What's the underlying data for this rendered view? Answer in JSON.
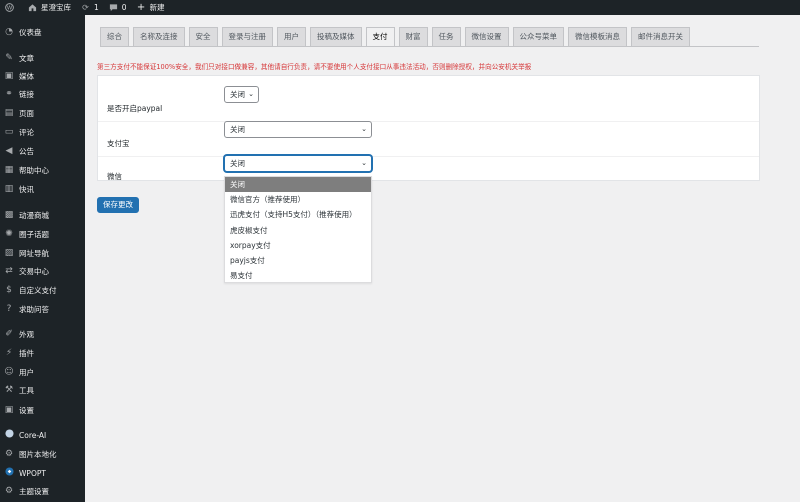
{
  "adminbar": {
    "site_name": "星澄宝库",
    "updates_count": "1",
    "comments_count": "0",
    "new_label": "新建"
  },
  "sidebar": {
    "items": [
      {
        "label": "仪表盘",
        "icon": "dashboard-icon"
      },
      {
        "label": "文章",
        "icon": "pin-icon"
      },
      {
        "label": "媒体",
        "icon": "media-icon"
      },
      {
        "label": "链接",
        "icon": "link-icon"
      },
      {
        "label": "页面",
        "icon": "page-icon"
      },
      {
        "label": "评论",
        "icon": "comment-icon"
      },
      {
        "label": "公告",
        "icon": "megaphone-icon"
      },
      {
        "label": "帮助中心",
        "icon": "calendar-icon"
      },
      {
        "label": "快讯",
        "icon": "document-icon"
      },
      {
        "label": "动漫商城",
        "icon": "store-icon"
      },
      {
        "label": "圈子话题",
        "icon": "circle-icon"
      },
      {
        "label": "网址导航",
        "icon": "nav-icon"
      },
      {
        "label": "交易中心",
        "icon": "exchange-icon"
      },
      {
        "label": "自定义支付",
        "icon": "dollar-icon"
      },
      {
        "label": "求助问答",
        "icon": "question-icon"
      },
      {
        "label": "外观",
        "icon": "brush-icon"
      },
      {
        "label": "插件",
        "icon": "plugin-icon"
      },
      {
        "label": "用户",
        "icon": "user-icon"
      },
      {
        "label": "工具",
        "icon": "wrench-icon"
      },
      {
        "label": "设置",
        "icon": "settings-icon"
      },
      {
        "label": "Core-AI",
        "icon": "ai-icon"
      },
      {
        "label": "图片本地化",
        "icon": "gear-icon"
      },
      {
        "label": "WPOPT",
        "icon": "wpopt-icon"
      },
      {
        "label": "主题设置",
        "icon": "theme-gear-icon"
      }
    ]
  },
  "tabs": [
    {
      "label": "综合"
    },
    {
      "label": "名称及连接"
    },
    {
      "label": "安全"
    },
    {
      "label": "登录与注册"
    },
    {
      "label": "用户"
    },
    {
      "label": "投稿及媒体"
    },
    {
      "label": "支付"
    },
    {
      "label": "财富"
    },
    {
      "label": "任务"
    },
    {
      "label": "微信设置"
    },
    {
      "label": "公众号菜单"
    },
    {
      "label": "微信模板消息"
    },
    {
      "label": "邮件消息开关"
    }
  ],
  "notice": "第三方支付不能保证100%安全，我们只对接口做兼容，其他请自行负责，请不要使用个人支付接口从事违法活动，否则删除授权，并向公安机关举报",
  "form": {
    "paypal_label": "是否开启paypal",
    "paypal_value": "关闭",
    "alipay_label": "支付宝",
    "alipay_value": "关闭",
    "wechat_label": "微信",
    "wechat_value": "关闭"
  },
  "dropdown_options": [
    "关闭",
    "微信官方（推荐使用）",
    "迅虎支付（支持H5支付）（推荐使用）",
    "虎皮椒支付",
    "xorpay支付",
    "payjs支付",
    "易支付"
  ],
  "save_label": "保存更改",
  "colors": {
    "admin_dark": "#1d2327",
    "accent": "#2271b1",
    "notice_red": "#d63638",
    "selected_option": "#7e7e7e"
  }
}
